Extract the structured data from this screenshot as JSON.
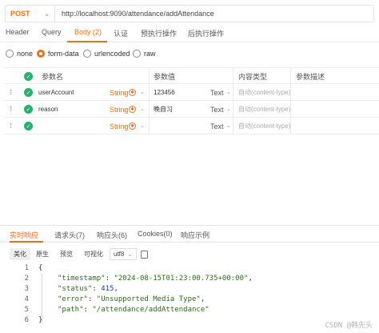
{
  "request": {
    "method": "POST",
    "url": "http://localhost:9090/attendance/addAttendance"
  },
  "req_tabs": [
    "Header",
    "Query",
    "Body (2)",
    "认证",
    "预执行操作",
    "后执行操作"
  ],
  "body_types": {
    "options": [
      "none",
      "form-data",
      "urlencoded",
      "raw"
    ],
    "selected": "form-data"
  },
  "params": {
    "headers": [
      "参数名",
      "参数值",
      "内容类型",
      "参数描述"
    ],
    "rows": [
      {
        "key": "userAccount",
        "type": "String",
        "value": "123456",
        "content_type": "Text",
        "content_ph": "自动(content-type)"
      },
      {
        "key": "reason",
        "type": "String",
        "value": "晚自习",
        "content_type": "Text",
        "content_ph": "自动(content-type)"
      },
      {
        "key": "",
        "type": "String",
        "value": "",
        "content_type": "Text",
        "content_ph": "自动(content-type)"
      }
    ]
  },
  "response": {
    "tabs": [
      "实时响应",
      "请求头(7)",
      "响应头(6)",
      "Cookies(0)",
      "响应示例"
    ],
    "views": [
      "美化",
      "原生",
      "预览",
      "可视化"
    ],
    "encoding": "utf8",
    "code_lines": [
      {
        "n": "1",
        "text": "{"
      },
      {
        "n": "2",
        "key": "\"timestamp\"",
        "val": "\"2024-08-15T01:23:00.735+00:00\"",
        "kind": "s",
        "tail": ","
      },
      {
        "n": "3",
        "key": "\"status\"",
        "val": "415",
        "kind": "n",
        "tail": ","
      },
      {
        "n": "4",
        "key": "\"error\"",
        "val": "\"Unsupported Media Type\"",
        "kind": "s",
        "tail": ","
      },
      {
        "n": "5",
        "key": "\"path\"",
        "val": "\"/attendance/addAttendance\"",
        "kind": "s",
        "tail": ""
      },
      {
        "n": "6",
        "text": "}"
      }
    ]
  },
  "watermark": "CSDN @韩先头",
  "colors": {
    "accent": "#e8721c",
    "success": "#26b16c",
    "number": "#1a3fb0",
    "string": "#2d6a1d"
  }
}
